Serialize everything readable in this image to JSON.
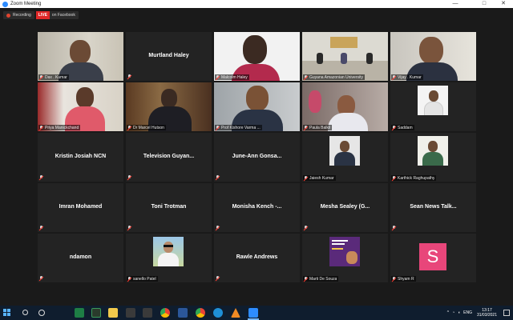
{
  "window": {
    "title": "Zoom Meeting",
    "controls": [
      "—",
      "□",
      "✕"
    ]
  },
  "recording": {
    "label": "Recording",
    "live_badge": "LIVE",
    "live_text": "on Facebook"
  },
  "tiles": [
    {
      "name": "Dax . Kumar",
      "kind": "video",
      "scene": "man-office",
      "labeled": true
    },
    {
      "name": "Murtland Haley",
      "kind": "name",
      "labeled": false
    },
    {
      "name": "Malcolm Haley",
      "kind": "video",
      "scene": "young-man",
      "labeled": true
    },
    {
      "name": "Guyana Amazonian University",
      "kind": "video",
      "scene": "room",
      "labeled": true,
      "active": true
    },
    {
      "name": "Vijay . Kumar",
      "kind": "video",
      "scene": "man-glasses",
      "labeled": true
    },
    {
      "name": "Priya Manickchand",
      "kind": "video",
      "scene": "woman-pink",
      "labeled": true
    },
    {
      "name": "Dr Marcel Hutson",
      "kind": "video",
      "scene": "man-suit",
      "labeled": true
    },
    {
      "name": "Prof Kishore Varma ...",
      "kind": "video",
      "scene": "man-tie",
      "labeled": true
    },
    {
      "name": "Paula Balkit",
      "kind": "video",
      "scene": "woman-glasses",
      "labeled": true
    },
    {
      "name": "Saddam",
      "kind": "thumb",
      "scene": "man-white",
      "labeled": true
    },
    {
      "name": "Kristin Josiah NCN",
      "kind": "name",
      "labeled": false
    },
    {
      "name": "Television Guyan...",
      "kind": "name",
      "labeled": false
    },
    {
      "name": "June-Ann Gonsa...",
      "kind": "name",
      "labeled": false
    },
    {
      "name": "Jaiesh Kumar",
      "kind": "thumb",
      "scene": "man-suit-small",
      "labeled": true
    },
    {
      "name": "Karthick Raghupathy",
      "kind": "thumb",
      "scene": "man-green",
      "labeled": true
    },
    {
      "name": "Imran Mohamed",
      "kind": "name",
      "labeled": false
    },
    {
      "name": "Toni Trotman",
      "kind": "name",
      "labeled": false
    },
    {
      "name": "Monisha Kench -...",
      "kind": "name",
      "labeled": false
    },
    {
      "name": "Mesha Sealey (G...",
      "kind": "name",
      "labeled": false
    },
    {
      "name": "Sean News Talk...",
      "kind": "name",
      "labeled": false
    },
    {
      "name": "ndamon",
      "kind": "name",
      "labeled": false
    },
    {
      "name": "sanello Patel",
      "kind": "thumb",
      "scene": "woman-sunglasses",
      "labeled": true
    },
    {
      "name": "Rawle Andrews",
      "kind": "name",
      "labeled": false
    },
    {
      "name": "Marti De Souza",
      "kind": "thumb",
      "scene": "poster",
      "labeled": true
    },
    {
      "name": "Shyam R",
      "kind": "avatar",
      "initial": "S",
      "labeled": true
    }
  ],
  "taskbar": {
    "tray_language": "ENG",
    "time": "13:17",
    "date": "31/03/2021"
  },
  "colors": {
    "background": "#1a1a1a",
    "tile": "#232323",
    "active_border": "#b7d33a",
    "live_red": "#e02828",
    "taskbar": "#0f1d2e",
    "avatar_pink": "#e8467a"
  }
}
